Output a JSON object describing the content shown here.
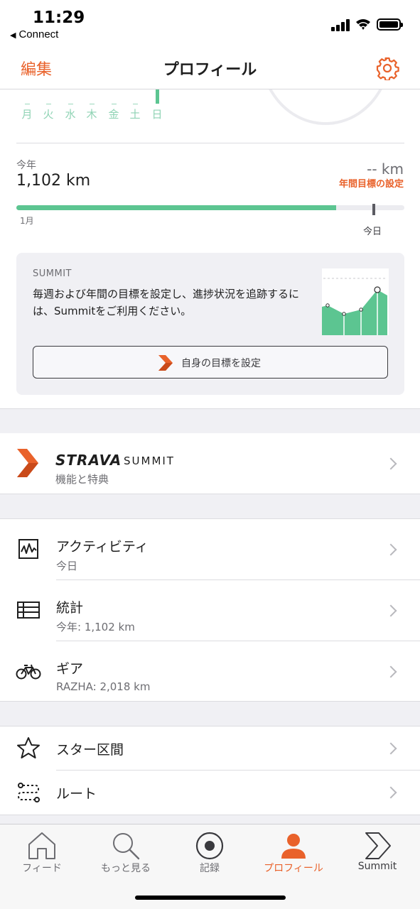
{
  "status_bar": {
    "time": "11:29",
    "back_app": "Connect"
  },
  "nav": {
    "edit_label": "編集",
    "title": "プロフィール",
    "settings_icon": "gear-icon"
  },
  "week": {
    "days": [
      "月",
      "火",
      "水",
      "木",
      "金",
      "土",
      "日"
    ],
    "today_index": 6
  },
  "year": {
    "label": "今年",
    "distance": "1,102 km",
    "goal_value": "-- km",
    "goal_link": "年間目標の設定",
    "progress_fraction": 0.825,
    "today_fraction": 0.918,
    "start_label": "1月",
    "today_label": "今日"
  },
  "summit_card": {
    "tag": "SUMMIT",
    "description": "毎週および年間の目標を設定し、進捗状況を追跡するには、Summitをご利用ください。",
    "button_label": "自身の目標を設定"
  },
  "strava_summit": {
    "brand": "STRAVA",
    "product": "SUMMIT",
    "subtitle": "機能と特典"
  },
  "menu": {
    "activities": {
      "label": "アクティビティ",
      "sub": "今日",
      "icon": "activity-icon"
    },
    "stats": {
      "label": "統計",
      "sub": "今年: 1,102 km",
      "icon": "table-icon"
    },
    "gear": {
      "label": "ギア",
      "sub": "RAZHA: 2,018 km",
      "icon": "bike-icon"
    },
    "starred": {
      "label": "スター区間",
      "icon": "star-icon"
    },
    "routes": {
      "label": "ルート",
      "icon": "route-icon"
    }
  },
  "tabs": [
    {
      "label": "フィード",
      "icon": "home-icon"
    },
    {
      "label": "もっと見る",
      "icon": "search-icon"
    },
    {
      "label": "記録",
      "icon": "record-icon"
    },
    {
      "label": "プロフィール",
      "icon": "profile-icon",
      "active": true
    },
    {
      "label": "Summit",
      "icon": "summit-icon"
    }
  ],
  "colors": {
    "accent": "#e9622b",
    "progress": "#5cc591",
    "week_text": "#8fd3b4"
  }
}
